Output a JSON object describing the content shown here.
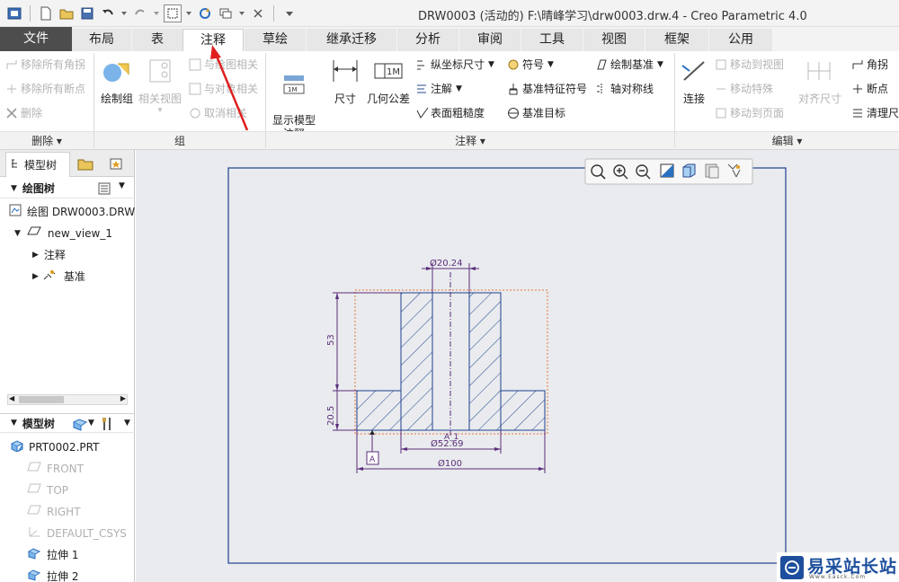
{
  "window": {
    "title": "DRW0003 (活动的) F:\\晴峰学习\\drw0003.drw.4 - Creo Parametric 4.0"
  },
  "tabs": [
    {
      "label": "文件",
      "active": false
    },
    {
      "label": "布局",
      "active": false
    },
    {
      "label": "表",
      "active": false
    },
    {
      "label": "注释",
      "active": true
    },
    {
      "label": "草绘",
      "active": false
    },
    {
      "label": "继承迁移",
      "active": false
    },
    {
      "label": "分析",
      "active": false
    },
    {
      "label": "审阅",
      "active": false
    },
    {
      "label": "工具",
      "active": false
    },
    {
      "label": "视图",
      "active": false
    },
    {
      "label": "框架",
      "active": false
    },
    {
      "label": "公用",
      "active": false
    }
  ],
  "ribbon": {
    "delete_group": {
      "items": [
        "移除所有角拐",
        "移除所有断点",
        "删除"
      ],
      "label": "删除"
    },
    "group_group": {
      "draw_group": "绘制组",
      "related_view": "相关视图",
      "related_drawing": "与绘图相关",
      "related_object": "与对象相关",
      "unrelate": "取消相关",
      "label": "组"
    },
    "annotation_group": {
      "show_model": "显示模型\n注释",
      "dimension": "尺寸",
      "gtol": "几何公差",
      "ordinate": "纵坐标尺寸",
      "note": "注解",
      "surface_finish": "表面粗糙度",
      "symbol": "符号",
      "datum_feature": "基准特征符号",
      "datum_target": "基准目标",
      "draw_datum": "绘制基准",
      "symmetry_line": "轴对称线",
      "label": "注释"
    },
    "edit_group": {
      "connect": "连接",
      "move_to_view": "移动到视图",
      "move_special": "移动特殊",
      "move_to_page": "移动到页面",
      "align_dim": "对齐尺寸",
      "corner": "角拐",
      "breakpoint": "断点",
      "cleanup": "清理尺寸",
      "label": "编辑"
    }
  },
  "left_panel": {
    "tabs": {
      "model_tree": "模型树"
    },
    "drawing_tree": {
      "header": "绘图树",
      "items": [
        "绘图 DRW0003.DRW",
        "new_view_1",
        "注释",
        "基准"
      ]
    },
    "model_tree": {
      "header": "模型树",
      "items": [
        "PRT0002.PRT",
        "FRONT",
        "TOP",
        "RIGHT",
        "DEFAULT_CSYS",
        "拉伸 1",
        "拉伸 2"
      ]
    }
  },
  "drawing": {
    "dims": {
      "top": "Ø20.24",
      "inner": "Ø52.69",
      "outer": "Ø100",
      "left_top": "53",
      "left_bottom": "20.5",
      "section": "A_1",
      "datum": "A"
    }
  },
  "watermark": {
    "text": "易采站长站",
    "sub": "Www.Easck.Com"
  },
  "colors": {
    "accent": "#1f5fa8",
    "dim": "#5a2d7a",
    "part": "#1f3f8f",
    "highlight": "#e8743b",
    "arrow": "#e02020"
  }
}
